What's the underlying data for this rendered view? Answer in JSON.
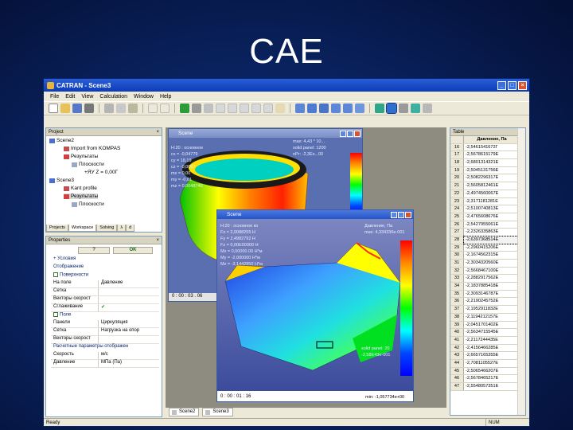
{
  "slide": {
    "title": "CAE"
  },
  "app": {
    "title": "CATRAN - Scene3",
    "menu": [
      "File",
      "Edit",
      "View",
      "Calculation",
      "Window",
      "Help"
    ]
  },
  "project": {
    "header": "Project",
    "tree": [
      {
        "label": "Scene2",
        "level": 0
      },
      {
        "label": "Import from KOMPAS",
        "level": 1
      },
      {
        "label": "Результаты",
        "level": 1
      },
      {
        "label": "Плоскости",
        "level": 2
      },
      {
        "label": "+ЯУ Z = 0,00Г",
        "level": 3
      },
      {
        "label": "Scene3",
        "level": 0
      },
      {
        "label": "Kant profile",
        "level": 1
      },
      {
        "label": "Результаты",
        "level": 1
      },
      {
        "label": "Плоскости",
        "level": 2
      }
    ],
    "tabs": [
      "Projects",
      "Workspace",
      "Solving",
      "λ",
      "d"
    ]
  },
  "properties": {
    "header": "Properties",
    "buttons": [
      "?",
      "OK"
    ],
    "rows": [
      {
        "type": "cat",
        "k": "Условия"
      },
      {
        "type": "cat",
        "k": "Отображение"
      },
      {
        "type": "check",
        "k": "Поверхности"
      },
      {
        "type": "row",
        "k": "На поле",
        "v": "Давление"
      },
      {
        "type": "row",
        "k": "Сетка",
        "v": ""
      },
      {
        "type": "row",
        "k": "Векторы скорост",
        "v": ""
      },
      {
        "type": "row",
        "k": "Сглаживание",
        "v": "✔"
      },
      {
        "type": "check",
        "k": "Поле"
      },
      {
        "type": "row",
        "k": "Панели",
        "v": "Циркуляция"
      },
      {
        "type": "row",
        "k": "Сетка",
        "v": "Нагрузка на опор"
      },
      {
        "type": "row",
        "k": "Векторы скорост",
        "v": ""
      },
      {
        "type": "cat",
        "k": "Расчетные параметры отображен"
      },
      {
        "type": "row",
        "k": "Скорость",
        "v": "м/с"
      },
      {
        "type": "row",
        "k": "Давление",
        "v": "МПа (Па)"
      }
    ]
  },
  "scene_back": {
    "title": "Scene",
    "overlay_left": "Н:20 : основное\ncx = -0,04779\ncy = 18,19\ncz = -0,0057\nmx = 0,00\nmy = -0,01\nmz = 0,0048740",
    "overlay_right": "max: 4,43 * 10...\nsolid panel: 1200\nnPr: -2,3Ex...00",
    "time": "0 : 00 : 03 . 06"
  },
  "scene_front": {
    "title": "Scene",
    "overlay_left": "Н:20 : основное ко\nFx = 2,0088255 Н\nFy = 2,4982792 Н\nFz = 0,00E00000 Н\nMx = 0,00000.00 Н*м\nMy = -2,000000 Н*м\nMz = -3,1442850 Н*м",
    "overlay_right": "Давление, Па\nmax: 4,334336e-001",
    "overlay_bottom": "solid panel: 20\n-2,58E43e-001",
    "min": "min: -1,057734e+00",
    "time": "0 : 00 : 01 : 16"
  },
  "scene_tabs": [
    "Scene2",
    "Scene3"
  ],
  "table": {
    "header": "Table",
    "column": "Давление, Па",
    "rows": [
      {
        "n": "16",
        "v": "-2,5461541672Г"
      },
      {
        "n": "17",
        "v": "-2,5678615179Е"
      },
      {
        "n": "18",
        "v": "-2,6801314321Е"
      },
      {
        "n": "19",
        "v": "-2,5045131756Е"
      },
      {
        "n": "20",
        "v": "-2,5082296317Е"
      },
      {
        "n": "21",
        "v": "-2,5605812461Е"
      },
      {
        "n": "22",
        "v": "-2,4974560067Е"
      },
      {
        "n": "23",
        "v": "-2,3171181281Е"
      },
      {
        "n": "24",
        "v": "-2,5100740813Е"
      },
      {
        "n": "25",
        "v": "-2,4765608676Е"
      },
      {
        "n": "26",
        "v": "-2,5427955061Е"
      },
      {
        "n": "27",
        "v": "-2,2326335863Е"
      },
      {
        "n": "28",
        "v": "-2,6397368514Е"
      },
      {
        "n": "29",
        "v": "-2,2960415206Е"
      },
      {
        "n": "30",
        "v": "-2,1674562315Е"
      },
      {
        "n": "31",
        "v": "-2,3034320560Е"
      },
      {
        "n": "32",
        "v": "-2,5668467100Е"
      },
      {
        "n": "33",
        "v": "-2,2882917562Е"
      },
      {
        "n": "34",
        "v": "-2,1837885418Е"
      },
      {
        "n": "35",
        "v": "-2,3093146787Е"
      },
      {
        "n": "36",
        "v": "-2,2190245752Е"
      },
      {
        "n": "37",
        "v": "-2,1952911832Е"
      },
      {
        "n": "38",
        "v": "-2,1194212157Е"
      },
      {
        "n": "39",
        "v": "-2,0451701402Е"
      },
      {
        "n": "40",
        "v": "-2,5634715545Е"
      },
      {
        "n": "41",
        "v": "-2,2117244435Е"
      },
      {
        "n": "42",
        "v": "-2,4156466285Е"
      },
      {
        "n": "43",
        "v": "-2,6657165355Е"
      },
      {
        "n": "44",
        "v": "-2,7081105527Е"
      },
      {
        "n": "45",
        "v": "-2,5065466207Е"
      },
      {
        "n": "46",
        "v": "-2,5678465217Е"
      },
      {
        "n": "47",
        "v": "-2,5548057351Е"
      }
    ]
  },
  "status": {
    "left": "Ready",
    "right": "NUM"
  },
  "colors": {
    "slide_bg": "#0a2463",
    "title_bar": "#1c4fc8",
    "window_bg": "#ece9d8"
  }
}
